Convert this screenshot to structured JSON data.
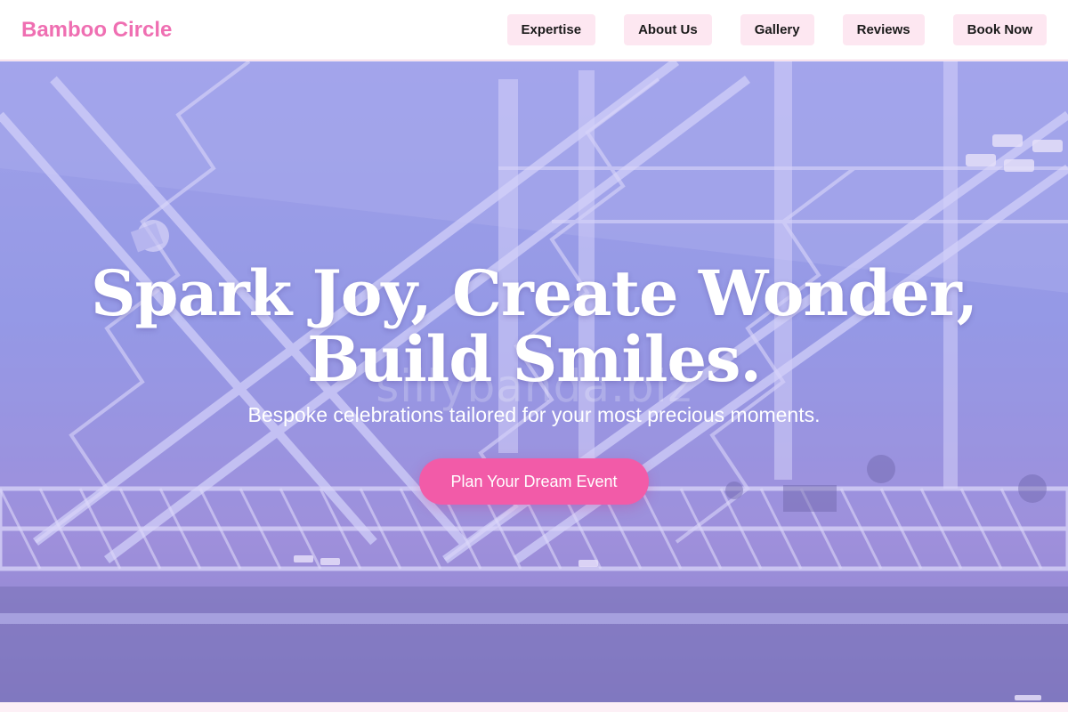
{
  "brand": {
    "name": "Bamboo Circle"
  },
  "nav": {
    "items": [
      {
        "label": "Expertise"
      },
      {
        "label": "About Us"
      },
      {
        "label": "Gallery"
      },
      {
        "label": "Reviews"
      },
      {
        "label": "Book Now"
      }
    ]
  },
  "hero": {
    "headline": "Spark Joy, Create Wonder, Build Smiles.",
    "subheadline": "Bespoke celebrations tailored for your most precious moments.",
    "cta_label": "Plan Your Dream Event",
    "watermark": "sillybanda.biz",
    "background_image": "stage-truss-lighting"
  },
  "colors": {
    "brand": "#ef6fb2",
    "nav_button_bg": "#fde7f1",
    "cta": "#f25ba8",
    "hero_tint": "#8f9be6"
  }
}
